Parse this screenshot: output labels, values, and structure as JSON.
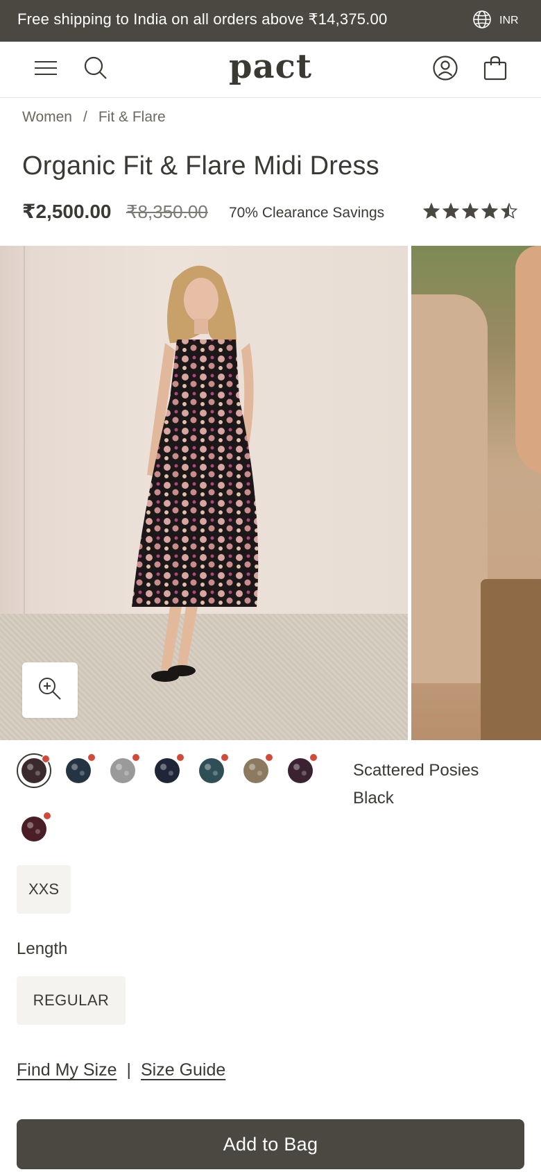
{
  "promo": {
    "text": "Free shipping to India on all orders above ₹14,375.00",
    "currency": "INR",
    "currency_icon": "globe-icon"
  },
  "header": {
    "logo": "pact",
    "menu_icon": "menu-icon",
    "search_icon": "search-icon",
    "account_icon": "account-icon",
    "bag_icon": "shopping-bag-icon"
  },
  "breadcrumb": {
    "items": [
      "Women",
      "Fit & Flare"
    ],
    "separator": "/"
  },
  "product": {
    "title": "Organic Fit & Flare Midi Dress",
    "price": "₹2,500.00",
    "original_price": "₹8,350.00",
    "savings": "70% Clearance Savings",
    "rating": 4.5,
    "rating_max": 5
  },
  "gallery": {
    "zoom_icon": "zoom-in-icon"
  },
  "colors": {
    "selected_name": "Scattered Posies Black",
    "swatches": [
      {
        "color": "#3a2a2e",
        "selected": true
      },
      {
        "color": "#243443",
        "selected": false
      },
      {
        "color": "#9a9a9a",
        "selected": false
      },
      {
        "color": "#1f2638",
        "selected": false
      },
      {
        "color": "#2f4f57",
        "selected": false
      },
      {
        "color": "#8c7a60",
        "selected": false
      },
      {
        "color": "#3a2230",
        "selected": false
      },
      {
        "color": "#4a1e26",
        "selected": false
      }
    ]
  },
  "size": {
    "option": "XXS"
  },
  "length": {
    "label": "Length",
    "option": "REGULAR"
  },
  "size_links": {
    "find_my_size": "Find My Size",
    "separator": "|",
    "size_guide": "Size Guide"
  },
  "cta": {
    "add_to_bag": "Add to Bag"
  },
  "theme": {
    "dark": "#4a4841",
    "text": "#3b3933",
    "availability_dot": "#d04a3a"
  }
}
